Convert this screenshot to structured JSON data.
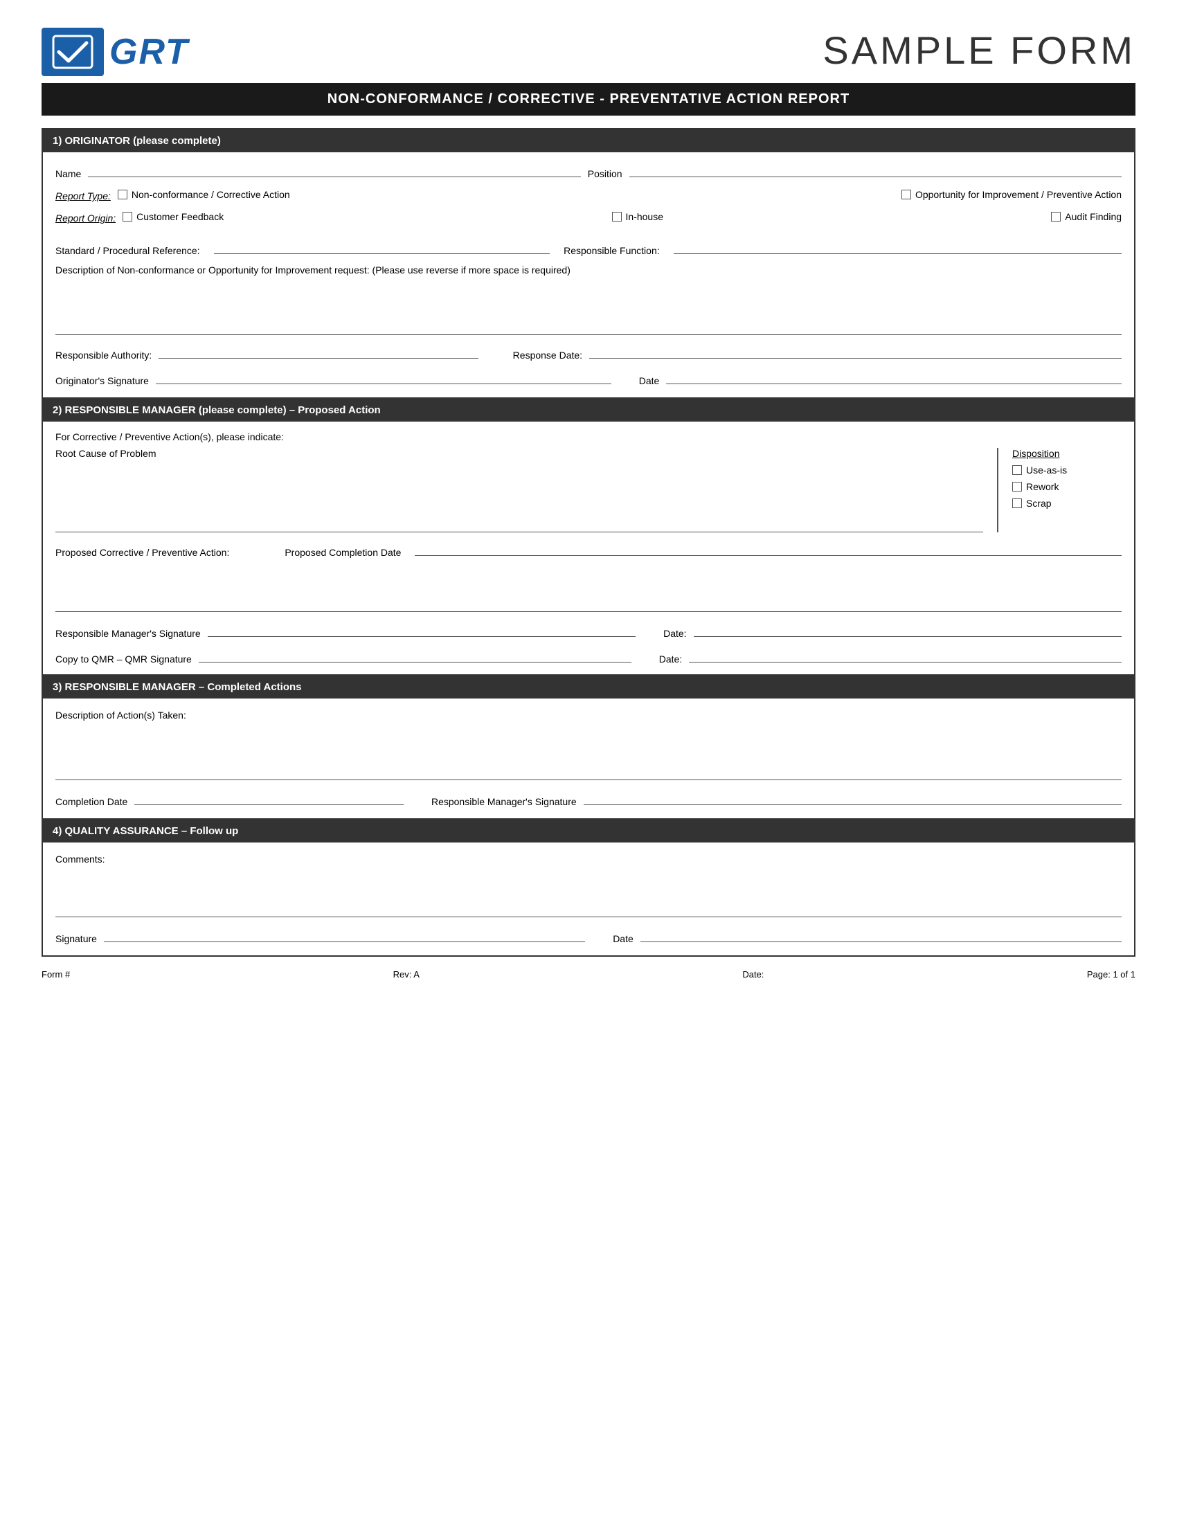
{
  "header": {
    "sample_form": "SAMPLE FORM",
    "grt_text": "GRT",
    "main_title": "NON-CONFORMANCE / CORRECTIVE - PREVENTATIVE ACTION REPORT"
  },
  "section1": {
    "title": "1) ORIGINATOR (please complete)",
    "name_label": "Name",
    "position_label": "Position",
    "report_type_label": "Report Type:",
    "report_type_option1": "Non-conformance / Corrective Action",
    "report_type_option2": "Opportunity for Improvement / Preventive Action",
    "report_origin_label": "Report Origin:",
    "report_origin_option1": "Customer Feedback",
    "report_origin_option2": "In-house",
    "report_origin_option3": "Audit Finding",
    "standard_ref_label": "Standard / Procedural Reference:",
    "responsible_function_label": "Responsible Function:",
    "description_label": "Description of Non-conformance or Opportunity for Improvement request: (Please use reverse if more space is required)",
    "responsible_authority_label": "Responsible Authority:",
    "response_date_label": "Response Date:",
    "originator_sig_label": "Originator's Signature",
    "date_label": "Date"
  },
  "section2": {
    "title": "2) RESPONSIBLE MANAGER (please complete) – Proposed Action",
    "for_corrective_label": "For Corrective / Preventive Action(s), please indicate:",
    "root_cause_label": "Root Cause of Problem",
    "disposition_title": "Disposition",
    "disposition_option1": "Use-as-is",
    "disposition_option2": "Rework",
    "disposition_option3": "Scrap",
    "proposed_action_label": "Proposed Corrective / Preventive Action:",
    "proposed_completion_label": "Proposed Completion Date",
    "manager_sig_label": "Responsible Manager's Signature",
    "date_label": "Date:",
    "qmr_label": "Copy to QMR – QMR Signature",
    "date_label2": "Date:"
  },
  "section3": {
    "title": "3) RESPONSIBLE MANAGER – Completed Actions",
    "description_label": "Description of Action(s) Taken:",
    "completion_date_label": "Completion Date",
    "manager_sig_label": "Responsible Manager's Signature"
  },
  "section4": {
    "title": "4) QUALITY ASSURANCE – Follow up",
    "comments_label": "Comments:",
    "signature_label": "Signature",
    "date_label": "Date"
  },
  "footer": {
    "form_label": "Form #",
    "rev_label": "Rev: A",
    "date_label": "Date:",
    "page_label": "Page: 1 of 1"
  }
}
